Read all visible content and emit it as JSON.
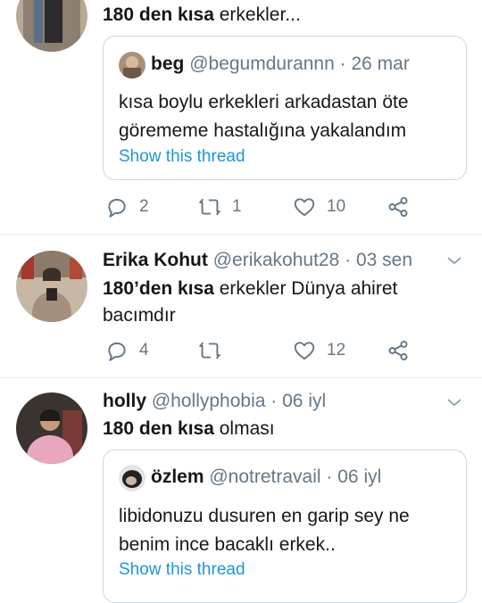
{
  "tweets": [
    {
      "text_bold": "180 den kısa",
      "text_rest": " erkekler...",
      "quote": {
        "name": "beg",
        "handle": "@begumdurannn",
        "date": "26 mar",
        "text_line1": "kısa boylu erkekleri arkadastan öte",
        "text_line2": "görememe hastalığına yakalandım",
        "link": "Show this thread"
      },
      "reply_count": "2",
      "retweet_count": "1",
      "like_count": "10"
    },
    {
      "name": "Erika Kohut",
      "handle": "@erikakohut28",
      "date": "03 sen",
      "text_bold": "180’den kısa",
      "text_rest": " erkekler Dünya ahiret",
      "text_line2": "bacımdır",
      "reply_count": "4",
      "retweet_count": "",
      "like_count": "12"
    },
    {
      "name": "holly",
      "handle": "@hollyphobia",
      "date": "06 iyl",
      "text_bold": "180 den kısa",
      "text_rest": " olması",
      "quote": {
        "name": "özlem",
        "handle": "@notretravail",
        "date": "06 iyl",
        "text_line1": "libidonuzu dusuren en garip sey ne",
        "text_line2": "benim ince bacaklı erkek..",
        "link": "Show this thread"
      }
    }
  ],
  "separator": "·",
  "colors": {
    "muted": "#657786",
    "link": "#1b95e0",
    "border": "#e6ecf0"
  },
  "icons": [
    "reply-icon",
    "retweet-icon",
    "like-icon",
    "share-icon",
    "chevron-down-icon"
  ]
}
